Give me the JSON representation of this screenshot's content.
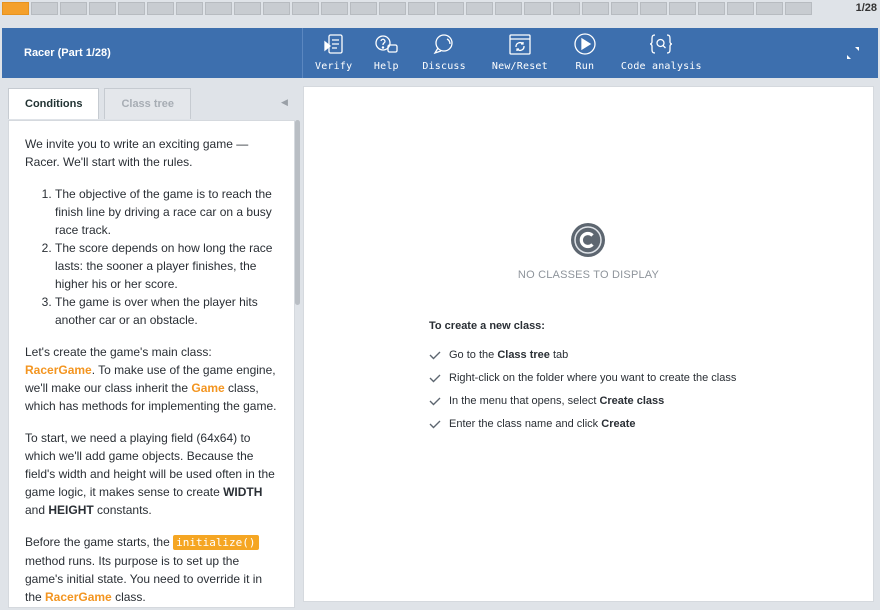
{
  "progress": {
    "total_segments": 28,
    "current_segment": 1,
    "counter": "1/28"
  },
  "header": {
    "title": "Racer (Part 1/28)",
    "tools": [
      {
        "label": "Verify",
        "icon": "verify-icon"
      },
      {
        "label": "Help",
        "icon": "help-icon"
      },
      {
        "label": "Discuss",
        "icon": "discuss-icon"
      },
      {
        "label": "New/Reset",
        "icon": "reset-icon"
      },
      {
        "label": "Run",
        "icon": "run-icon"
      },
      {
        "label": "Code analysis",
        "icon": "code-analysis-icon"
      }
    ]
  },
  "left": {
    "tabs": [
      {
        "label": "Conditions",
        "active": true
      },
      {
        "label": "Class tree",
        "active": false
      }
    ],
    "intro": "We invite you to write an exciting game — Racer. We'll start with the rules.",
    "rules": [
      "The objective of the game is to reach the finish line by driving a race car on a busy race track.",
      "The score depends on how long the race lasts: the sooner a player finishes, the higher his or her score.",
      "The game is over when the player hits another car or an obstacle."
    ],
    "p2": {
      "a": "Let's create the game's main class: ",
      "class1": "RacerGame",
      "b": ". To make use of the game engine, we'll make our class inherit the ",
      "class2": "Game",
      "c": " class, which has methods for implementing the game."
    },
    "p3": {
      "a": "To start, we need a playing field (64x64) to which we'll add game objects. Because the field's width and height will be used often in the game logic, it makes sense to create ",
      "w": "WIDTH",
      "and": " and ",
      "h": "HEIGHT",
      "c": " constants."
    },
    "p4": {
      "a": "Before the game starts, the ",
      "code": "initialize()",
      "b": " method runs. Its purpose is to set up the game's initial state. You need to override it in the ",
      "cls": "RacerGame",
      "c": " class."
    }
  },
  "right": {
    "empty_text": "NO CLASSES TO DISPLAY",
    "how_title": "To create a new class:",
    "steps": [
      {
        "a": "Go to the ",
        "b": "Class tree",
        "c": " tab"
      },
      {
        "a": "Right-click on the folder where you want to create the class",
        "b": "",
        "c": ""
      },
      {
        "a": "In the menu that opens, select ",
        "b": "Create class",
        "c": ""
      },
      {
        "a": "Enter the class name and click ",
        "b": "Create",
        "c": ""
      }
    ]
  },
  "colors": {
    "header_bg": "#3d6fae",
    "accent": "#f39520",
    "progress_active": "#f4a02c"
  }
}
